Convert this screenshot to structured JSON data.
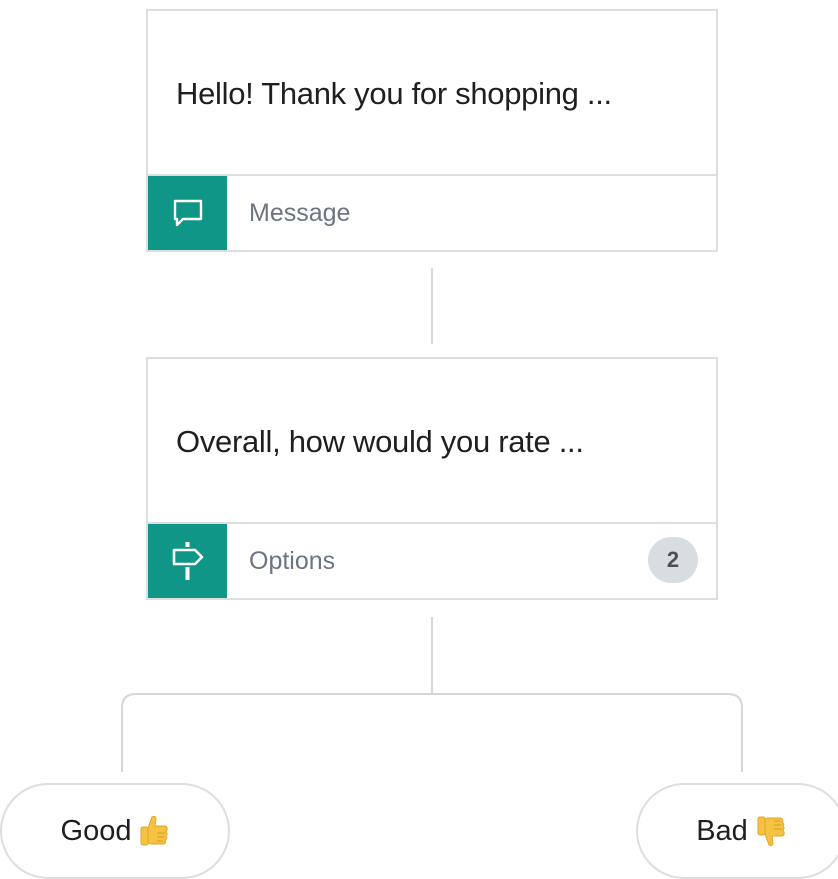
{
  "nodes": [
    {
      "text": "Hello! Thank you for shopping ...",
      "type_label": "Message",
      "icon": "message-icon"
    },
    {
      "text": "Overall, how would you rate ...",
      "type_label": "Options",
      "icon": "signpost-icon",
      "count": "2"
    }
  ],
  "options": [
    {
      "label": "Good",
      "emoji": "thumbs-up-icon"
    },
    {
      "label": "Bad",
      "emoji": "thumbs-down-icon"
    }
  ],
  "colors": {
    "accent": "#0f9686",
    "border": "#dedede",
    "label": "#6b7480"
  }
}
